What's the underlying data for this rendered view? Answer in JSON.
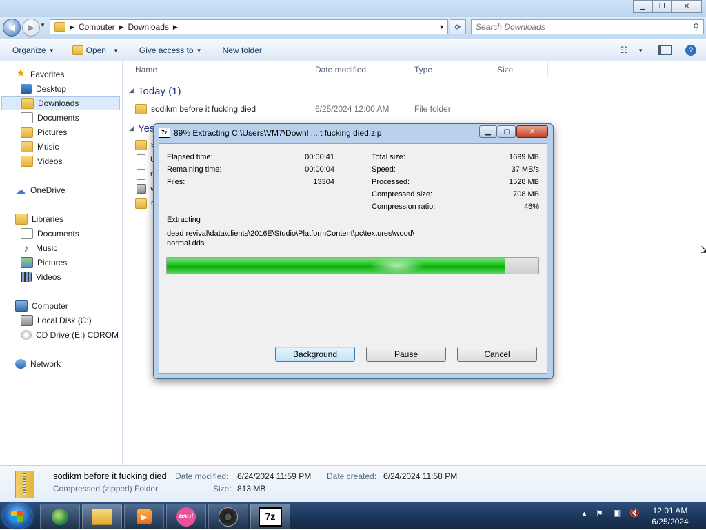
{
  "explorer": {
    "breadcrumb": [
      "Computer",
      "Downloads"
    ],
    "search_placeholder": "Search Downloads",
    "toolbar": {
      "organize": "Organize",
      "open": "Open",
      "give_access": "Give access to",
      "new_folder": "New folder"
    },
    "nav": {
      "favorites": "Favorites",
      "desktop": "Desktop",
      "downloads": "Downloads",
      "documents": "Documents",
      "pictures": "Pictures",
      "music": "Music",
      "videos": "Videos",
      "onedrive": "OneDrive",
      "libraries": "Libraries",
      "lib_documents": "Documents",
      "lib_music": "Music",
      "lib_pictures": "Pictures",
      "lib_videos": "Videos",
      "computer": "Computer",
      "local_disk": "Local Disk (C:)",
      "cd_drive": "CD Drive (E:) CDROM",
      "network": "Network"
    },
    "columns": {
      "name": "Name",
      "date_modified": "Date modified",
      "type": "Type",
      "size": "Size"
    },
    "groups": {
      "today": "Today (1)",
      "yesterday_partial": "Yes"
    },
    "rows": [
      {
        "name": "sodikm before it fucking died",
        "date": "6/25/2024 12:00 AM",
        "type": "File folder"
      }
    ],
    "partial_row_letters": [
      "s",
      "U",
      "r",
      "v",
      "r"
    ]
  },
  "details": {
    "name": "sodikm before it fucking died",
    "kind": "Compressed (zipped) Folder",
    "date_modified_label": "Date modified:",
    "date_modified": "6/24/2024 11:59 PM",
    "date_created_label": "Date created:",
    "date_created": "6/24/2024 11:58 PM",
    "size_label": "Size:",
    "size": "813 MB"
  },
  "dialog": {
    "title": "89% Extracting C:\\Users\\VM7\\Downl ... t fucking died.zip",
    "app_icon": "7z",
    "left_stats": [
      {
        "label": "Elapsed time:",
        "value": "00:00:41"
      },
      {
        "label": "Remaining time:",
        "value": "00:00:04"
      },
      {
        "label": "Files:",
        "value": "13304"
      }
    ],
    "right_stats": [
      {
        "label": "Total size:",
        "value": "1699 MB"
      },
      {
        "label": "Speed:",
        "value": "37 MB/s"
      },
      {
        "label": "Processed:",
        "value": "1528 MB"
      },
      {
        "label": "Compressed size:",
        "value": "708 MB"
      },
      {
        "label": "Compression ratio:",
        "value": "46%"
      }
    ],
    "action": "Extracting",
    "current_file_line1": "dead revival\\data\\clients\\2016E\\Studio\\PlatformContent\\pc\\textures\\wood\\",
    "current_file_line2": "normal.dds",
    "progress_fraction": 0.91,
    "buttons": {
      "background": "Background",
      "pause": "Pause",
      "cancel": "Cancel"
    }
  },
  "taskbar": {
    "apps": [
      "internet-explorer-icon",
      "file-explorer-icon",
      "media-player-icon",
      "osu-icon",
      "obs-icon",
      "7zip-icon"
    ],
    "osu_label": "osu!",
    "sevenzip_label": "7z",
    "clock_time": "12:01 AM",
    "clock_date": "6/25/2024"
  },
  "colors": {
    "progress_green": "#1ec31e",
    "group_header": "#1e3287",
    "taskbar": "#1a3457"
  }
}
